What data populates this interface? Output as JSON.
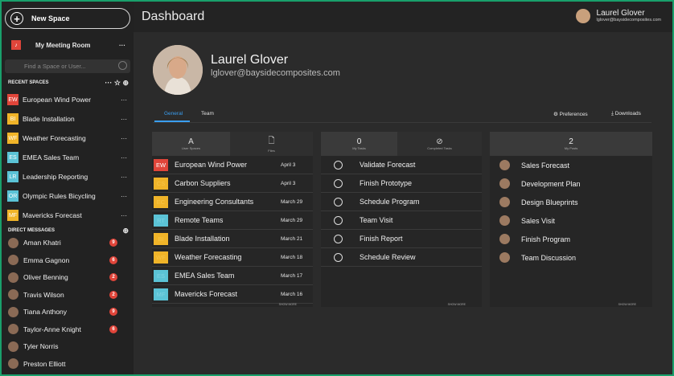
{
  "sidebar": {
    "new_space": "New Space",
    "meeting_room": "My Meeting Room",
    "search_placeholder": "Find a Space or User...",
    "recent_spaces_label": "RECENT SPACES",
    "direct_messages_label": "DIRECT MESSAGES",
    "spaces": [
      {
        "abbr": "EW",
        "name": "European Wind Power",
        "color": "#e0453a"
      },
      {
        "abbr": "BI",
        "name": "Blade Installation",
        "color": "#f0b429"
      },
      {
        "abbr": "WF",
        "name": "Weather Forecasting",
        "color": "#f0b429"
      },
      {
        "abbr": "ES",
        "name": "EMEA Sales Team",
        "color": "#5bc3d6"
      },
      {
        "abbr": "LR",
        "name": "Leadership Reporting",
        "color": "#5bc3d6"
      },
      {
        "abbr": "OR",
        "name": "Olympic Rules Bicycling",
        "color": "#5bc3d6"
      },
      {
        "abbr": "MF",
        "name": "Mavericks Forecast",
        "color": "#f0b429"
      }
    ],
    "dms": [
      {
        "name": "Aman Khatri",
        "badge": "9"
      },
      {
        "name": "Emma Gagnon",
        "badge": "6"
      },
      {
        "name": "Oliver Benning",
        "badge": "2"
      },
      {
        "name": "Travis Wilson",
        "badge": "2"
      },
      {
        "name": "Tiana Anthony",
        "badge": "9"
      },
      {
        "name": "Taylor-Anne Knight",
        "badge": "6"
      },
      {
        "name": "Tyler Norris",
        "badge": ""
      },
      {
        "name": "Preston Elliott",
        "badge": ""
      }
    ]
  },
  "header": {
    "title": "Dashboard",
    "user_name": "Laurel Glover",
    "user_email": "lglover@baysidecomposites.com"
  },
  "profile": {
    "name": "Laurel Glover",
    "email": "lglover@baysidecomposites.com"
  },
  "tabs": {
    "general": "General",
    "team": "Team",
    "preferences": "Preferences",
    "downloads": "Downloads"
  },
  "panel_spaces": {
    "head_left": "User Spaces",
    "head_right": "Files",
    "show_more": "SHOW MORE",
    "rows": [
      {
        "abbr": "EW",
        "name": "European Wind Power",
        "date": "April 3",
        "color": "#e0453a"
      },
      {
        "abbr": "CS",
        "name": "Carbon Suppliers",
        "date": "April 3",
        "color": "#f0b429"
      },
      {
        "abbr": "EC",
        "name": "Engineering Consultants",
        "date": "March 29",
        "color": "#f0b429"
      },
      {
        "abbr": "RT",
        "name": "Remote Teams",
        "date": "March 29",
        "color": "#5bc3d6"
      },
      {
        "abbr": "BI",
        "name": "Blade Installation",
        "date": "March 21",
        "color": "#f0b429"
      },
      {
        "abbr": "WF",
        "name": "Weather Forecasting",
        "date": "March 18",
        "color": "#f0b429"
      },
      {
        "abbr": "ES",
        "name": "EMEA Sales Team",
        "date": "March 17",
        "color": "#5bc3d6"
      },
      {
        "abbr": "MF",
        "name": "Mavericks Forecast",
        "date": "March 16",
        "color": "#5bc3d6"
      }
    ]
  },
  "panel_tasks": {
    "count": "0",
    "head_left": "My Tasks",
    "head_right": "Completed Tasks",
    "show_more": "SHOW MORE",
    "rows": [
      "Validate Forecast",
      "Finish Prototype",
      "Schedule Program",
      "Team Visit",
      "Finish Report",
      "Schedule Review"
    ]
  },
  "panel_posts": {
    "count": "2",
    "head": "My Posts",
    "show_more": "SHOW MORE",
    "rows": [
      "Sales Forecast",
      "Development Plan",
      "Design Blueprints",
      "Sales Visit",
      "Finish Program",
      "Team Discussion"
    ]
  }
}
